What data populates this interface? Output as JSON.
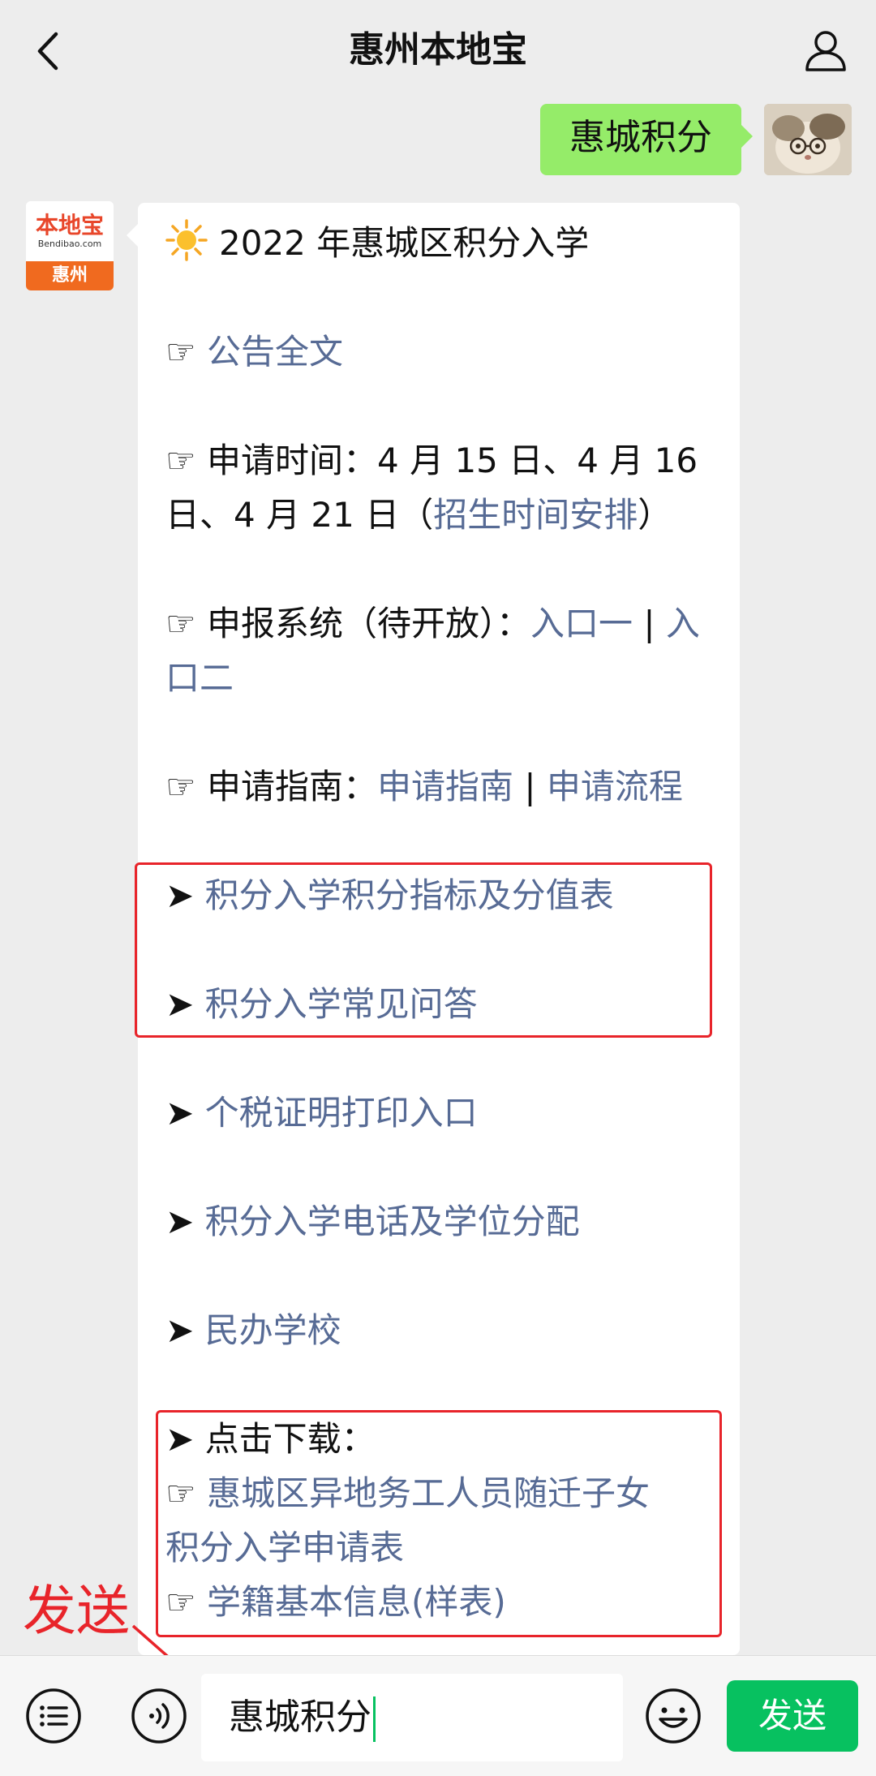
{
  "header": {
    "title": "惠州本地宝"
  },
  "sent_message": {
    "text": "惠城积分"
  },
  "sender_avatar": {
    "logo_cn": "本地宝",
    "logo_en": "Bendibao.com",
    "logo_city": "惠州"
  },
  "received": {
    "line1": "2022 年惠城区积分入学",
    "notice": {
      "bullet": "☞",
      "link": "公告全文"
    },
    "apply_time": {
      "bullet": "☞",
      "line1": "申请时间：4 月 15 日、4 月 16",
      "line2_text": "日、4 月 21 日（",
      "line2_link": "招生时间安排",
      "line2_end": "）"
    },
    "system": {
      "bullet": "☞",
      "text": "申报系统（待开放）：",
      "link1": "入口一",
      "sep": " | ",
      "link2_a": "入",
      "link2_b": "口二"
    },
    "guide": {
      "bullet": "☞",
      "text": "申请指南：",
      "link1": "申请指南",
      "sep": " | ",
      "link2": "申请流程"
    },
    "arrow": "➤",
    "items": [
      "积分入学积分指标及分值表",
      "积分入学常见问答",
      "个税证明打印入口",
      "积分入学电话及学位分配",
      "民办学校"
    ],
    "download": {
      "label": "点击下载：",
      "bullet": "☞",
      "link1_a": "惠城区异地务工人员随迁子女",
      "link1_b": "积分入学申请表",
      "link2": "学籍基本信息(样表)"
    }
  },
  "annotation": {
    "note": "发送"
  },
  "input": {
    "value": "惠城积分"
  },
  "bottom": {
    "send_label": "发送"
  },
  "colors": {
    "sent_bubble": "#95ec69",
    "link": "#576b95",
    "send_button": "#07c160",
    "highlight": "#e8242a"
  }
}
